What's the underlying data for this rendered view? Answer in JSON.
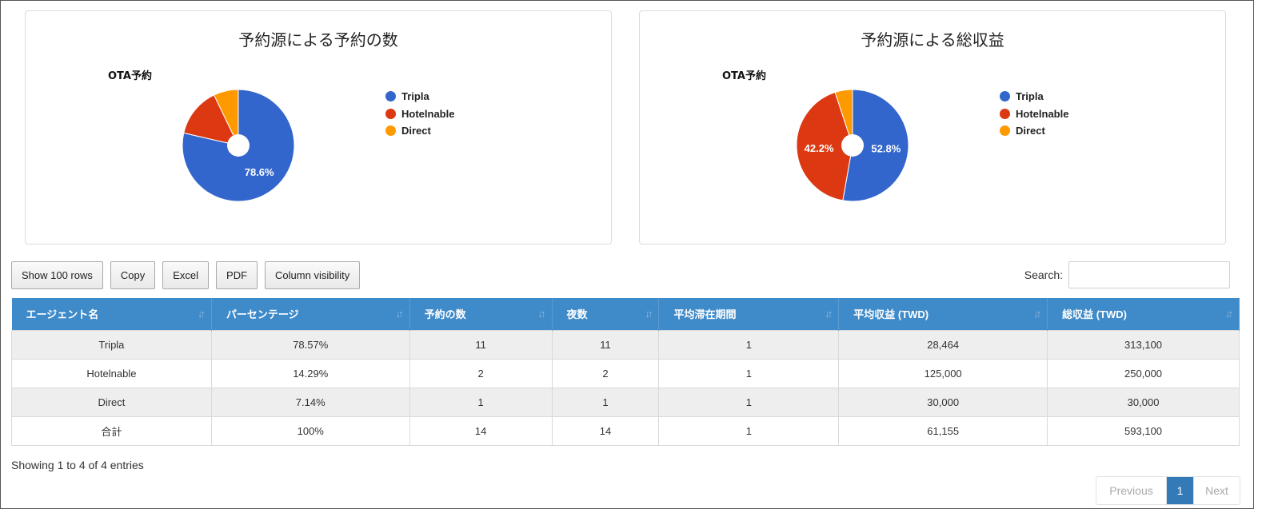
{
  "charts": [
    {
      "title": "予約源による予約の数",
      "subtitle": "OTA予約",
      "legend": [
        "Tripla",
        "Hotelnable",
        "Direct"
      ],
      "colors": [
        "#3366cc",
        "#dc3912",
        "#ff9900"
      ],
      "slice_labels": [
        "78.6%",
        "",
        ""
      ]
    },
    {
      "title": "予約源による総収益",
      "subtitle": "OTA予約",
      "legend": [
        "Tripla",
        "Hotelnable",
        "Direct"
      ],
      "colors": [
        "#3366cc",
        "#dc3912",
        "#ff9900"
      ],
      "slice_labels": [
        "52.8%",
        "42.2%",
        ""
      ]
    }
  ],
  "chart_data": [
    {
      "type": "pie",
      "title": "予約源による予約の数",
      "subtitle": "OTA予約",
      "categories": [
        "Tripla",
        "Hotelnable",
        "Direct"
      ],
      "values": [
        11,
        2,
        1
      ],
      "legend_position": "right",
      "donut": true
    },
    {
      "type": "pie",
      "title": "予約源による総収益",
      "subtitle": "OTA予約",
      "categories": [
        "Tripla",
        "Hotelnable",
        "Direct"
      ],
      "values": [
        313100,
        250000,
        30000
      ],
      "legend_position": "right",
      "donut": true
    }
  ],
  "toolbar": {
    "buttons": [
      "Show 100 rows",
      "Copy",
      "Excel",
      "PDF",
      "Column visibility"
    ],
    "search_label": "Search:",
    "search_value": ""
  },
  "table": {
    "headers": [
      "エージェント名",
      "パーセンテージ",
      "予約の数",
      "夜数",
      "平均滞在期間",
      "平均収益 (TWD)",
      "総収益 (TWD)"
    ],
    "rows": [
      [
        "Tripla",
        "78.57%",
        "11",
        "11",
        "1",
        "28,464",
        "313,100"
      ],
      [
        "Hotelnable",
        "14.29%",
        "2",
        "2",
        "1",
        "125,000",
        "250,000"
      ],
      [
        "Direct",
        "7.14%",
        "1",
        "1",
        "1",
        "30,000",
        "30,000"
      ],
      [
        "合計",
        "100%",
        "14",
        "14",
        "1",
        "61,155",
        "593,100"
      ]
    ]
  },
  "footer": {
    "info": "Showing 1 to 4 of 4 entries",
    "previous": "Previous",
    "current_page": "1",
    "next": "Next"
  }
}
